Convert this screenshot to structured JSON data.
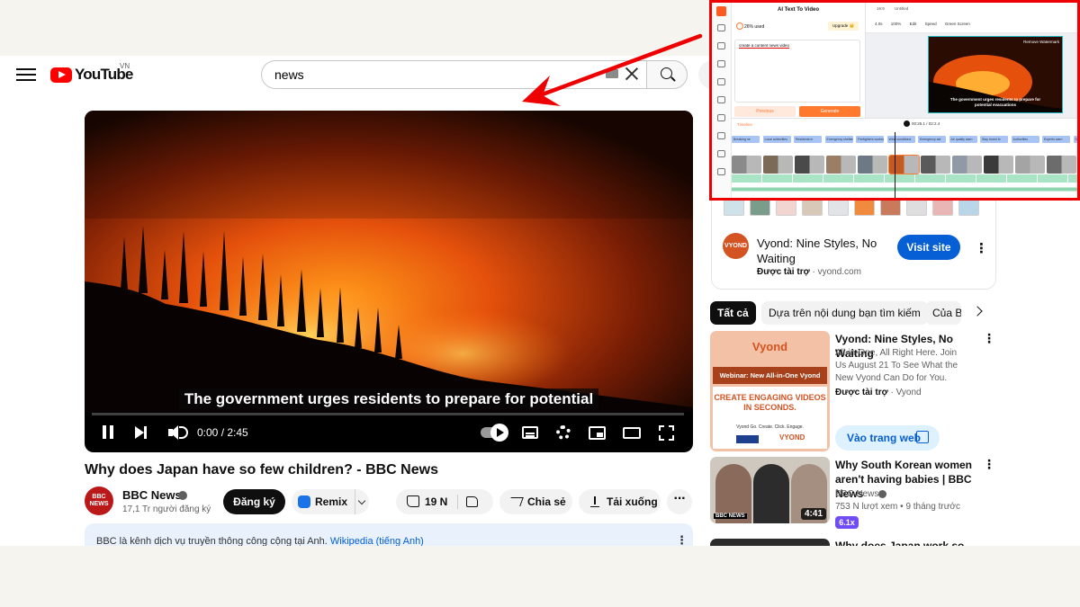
{
  "colors": {
    "youtube_red": "#ff0000",
    "annotation_red": "#ee0000",
    "accent_blue": "#065fd4",
    "vyond_orange": "#d35322",
    "editor_orange": "#ff7a2f"
  },
  "header": {
    "logo_text": "YouTube",
    "country_code": "VN",
    "search_value": "news"
  },
  "player": {
    "subtitle": "The government urges residents to prepare for potential",
    "time": "0:00 / 2:45",
    "progress": 0,
    "icons": [
      "pause-icon",
      "next-icon",
      "volume-icon",
      "autoplay-toggle",
      "subtitles-icon",
      "settings-icon",
      "miniplayer-icon",
      "theater-icon",
      "fullscreen-icon"
    ]
  },
  "video": {
    "title": "Why does Japan have so few children? - BBC News",
    "channel_name": "BBC News",
    "channel_avatar": "BBC NEWS",
    "subscribers": "17,1 Tr người đăng ký",
    "subscribe_label": "Đăng ký",
    "remix_label": "Remix",
    "likes": "19 N",
    "share_label": "Chia sẻ",
    "download_label": "Tải xuống",
    "info_text": "BBC là kênh dịch vụ truyền thông công cộng tại Anh.",
    "info_link": "Wikipedia (tiếng Anh)"
  },
  "sponsor_card": {
    "logo": "VYOND",
    "title": "Vyond: Nine Styles, No Waiting",
    "sponsored": "Được tài trợ",
    "domain": "vyond.com",
    "visit_label": "Visit site"
  },
  "chips": {
    "all": "Tất cả",
    "related": "Dựa trên nội dung bạn tìm kiếm",
    "from": "Của BBC News"
  },
  "related": {
    "ad": {
      "thumb_brand": "Vyond",
      "thumb_banner": "Webinar: New All-in-One Vyond",
      "thumb_headline": "CREATE ENGAGING VIDEOS IN SECONDS.",
      "thumb_tagline": "Vyond Go. Create. Click. Engage.",
      "thumb_mark": "VYOND",
      "title": "Vyond: Nine Styles, No Waiting",
      "desc": "All-in-One, All Right Here. Join Us August 21 To See What the New Vyond Can Do for You.",
      "sponsored": "Được tài trợ",
      "channel": "Vyond",
      "cta": "Vào trang web"
    },
    "video1": {
      "title": "Why South Korean women aren't having babies | BBC News",
      "channel": "BBC News",
      "meta": "753 N lượt xem  •  9 tháng trước",
      "duration": "4:41",
      "thumb_logo": "BBC NEWS",
      "speed": "6.1x"
    },
    "video2": {
      "title": "Why does Japan work so hard? |"
    }
  },
  "editor": {
    "panel_title": "AI Text To Video",
    "used": "26% used",
    "upgrade": "Upgrade 👑",
    "prompt": "create a content news video",
    "previous_label": "Previous",
    "generate_label": "Generate",
    "aspect": "16:9",
    "doc_name": "Untitled",
    "toolbar": [
      "4.0s",
      "100%",
      "Edit",
      "Speed",
      "Green Screen"
    ],
    "watermark": "Remove Watermark",
    "caption": "The government urges residents to prepare for potential evacuations",
    "timeline_label": "Timeline",
    "timecode": "00:25.1 / 02:2.4",
    "text_clips": [
      "Breaking ne",
      "Local authorities",
      "Residents in",
      "Emergency shelters",
      "Firefighters working",
      "Wind conditions",
      "Emergency aid",
      "Air quality warn",
      "Stay tuned fo",
      "Authorities",
      "Experts warn",
      "Stay"
    ]
  }
}
